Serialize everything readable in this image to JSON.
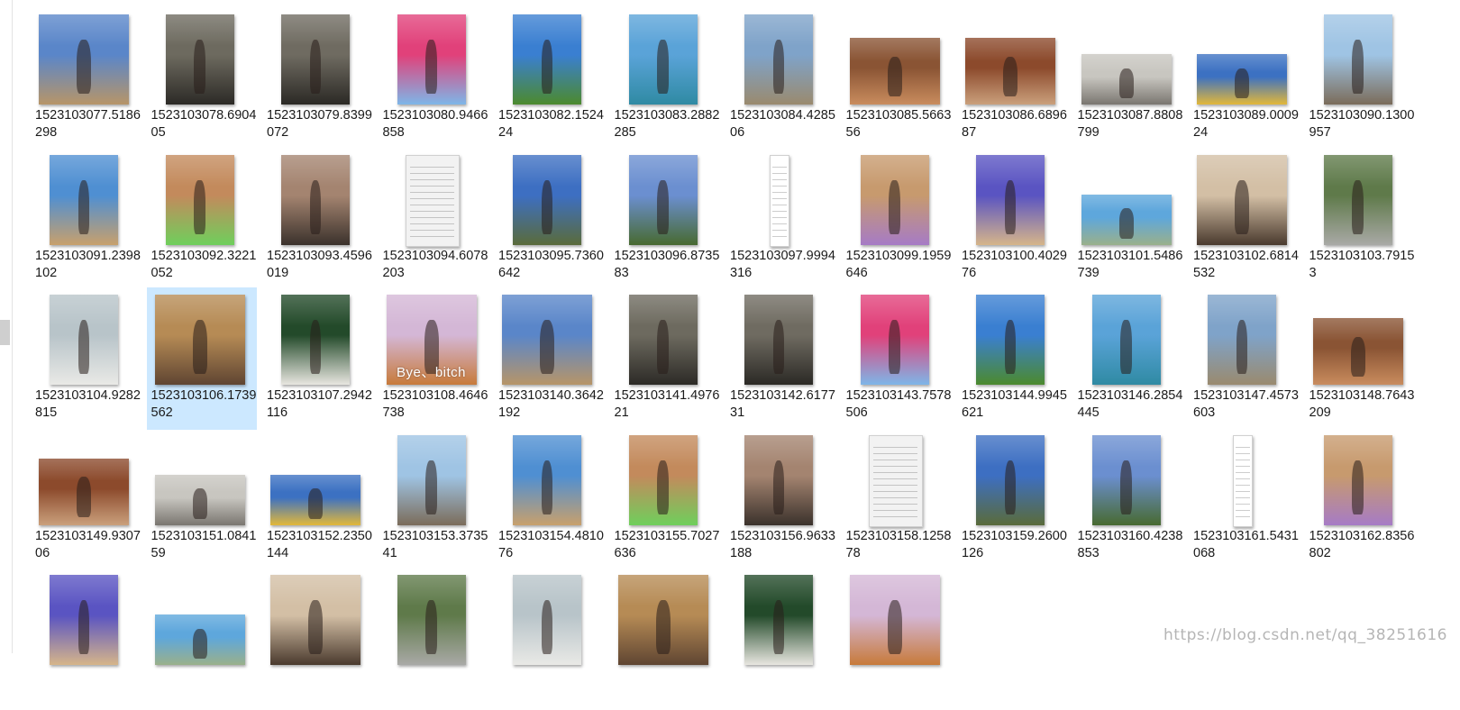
{
  "files": [
    {
      "name": "1523103077.5186298",
      "orientation": "square",
      "colors": [
        "#5a86c9",
        "#b79568"
      ]
    },
    {
      "name": "1523103078.690405",
      "orientation": "portrait",
      "colors": [
        "#6d6a5f",
        "#2c2a26"
      ]
    },
    {
      "name": "1523103079.8399072",
      "orientation": "portrait",
      "colors": [
        "#6f6b61",
        "#2b2925"
      ]
    },
    {
      "name": "1523103080.9466858",
      "orientation": "portrait",
      "colors": [
        "#e1417a",
        "#7eb6e8"
      ]
    },
    {
      "name": "1523103082.152424",
      "orientation": "portrait",
      "colors": [
        "#3a7fd1",
        "#4c8a2d"
      ]
    },
    {
      "name": "1523103083.2882285",
      "orientation": "portrait",
      "colors": [
        "#5aa3d8",
        "#2f8aa3"
      ]
    },
    {
      "name": "1523103084.428506",
      "orientation": "portrait",
      "colors": [
        "#7fa3c9",
        "#9a8a6e"
      ]
    },
    {
      "name": "1523103085.566356",
      "orientation": "landscape",
      "colors": [
        "#8a5434",
        "#c98c5e"
      ]
    },
    {
      "name": "1523103086.689687",
      "orientation": "landscape",
      "colors": [
        "#8c4a2c",
        "#caa07c"
      ]
    },
    {
      "name": "1523103087.8808799",
      "orientation": "wide",
      "colors": [
        "#c8c6c0",
        "#7a7670"
      ]
    },
    {
      "name": "1523103089.000924",
      "orientation": "wide",
      "colors": [
        "#3c71c2",
        "#e2b83a"
      ]
    },
    {
      "name": "1523103090.1300957",
      "orientation": "portrait",
      "colors": [
        "#9fc4e4",
        "#7b6c5a"
      ]
    },
    {
      "name": "1523103091.2398102",
      "orientation": "portrait",
      "colors": [
        "#4f8fd2",
        "#c8a06c"
      ]
    },
    {
      "name": "1523103092.3221052",
      "orientation": "portrait",
      "colors": [
        "#c38a5c",
        "#6fcf5c"
      ]
    },
    {
      "name": "1523103093.4596019",
      "orientation": "portrait",
      "colors": [
        "#a48470",
        "#3b322c"
      ]
    },
    {
      "name": "1523103094.6078203",
      "orientation": "document",
      "colors": [
        "#f2f2f2",
        "#b0b0b0"
      ]
    },
    {
      "name": "1523103095.7360642",
      "orientation": "portrait",
      "colors": [
        "#3d6fc2",
        "#5a6b3a"
      ]
    },
    {
      "name": "1523103096.873583",
      "orientation": "portrait",
      "colors": [
        "#6b8fd0",
        "#486a30"
      ]
    },
    {
      "name": "1523103097.9994316",
      "orientation": "strip",
      "colors": [
        "#ffffff",
        "#b8b8b8"
      ]
    },
    {
      "name": "1523103099.1959646",
      "orientation": "portrait",
      "colors": [
        "#c79a6e",
        "#a67bc6"
      ]
    },
    {
      "name": "1523103100.402976",
      "orientation": "portrait",
      "colors": [
        "#5a54c2",
        "#d6b58a"
      ]
    },
    {
      "name": "1523103101.5486739",
      "orientation": "wide",
      "colors": [
        "#5ea7dc",
        "#9ab08a"
      ]
    },
    {
      "name": "1523103102.6814532",
      "orientation": "square",
      "colors": [
        "#d3bfa5",
        "#4a3a2e"
      ]
    },
    {
      "name": "1523103103.79153",
      "orientation": "portrait",
      "colors": [
        "#5f7a4a",
        "#a9a9a6"
      ]
    },
    {
      "name": "1523103104.9282815",
      "orientation": "portrait",
      "colors": [
        "#b8c4c9",
        "#e9e9e6"
      ]
    },
    {
      "name": "1523103106.1739562",
      "orientation": "square",
      "colors": [
        "#b68b55",
        "#5f4532"
      ],
      "selected": true
    },
    {
      "name": "1523103107.2942116",
      "orientation": "portrait",
      "colors": [
        "#234a2a",
        "#e8e6e0"
      ]
    },
    {
      "name": "1523103108.4646738",
      "orientation": "square",
      "colors": [
        "#d4b7d6",
        "#c77a3a"
      ],
      "caption": "Bye、bitch"
    },
    {
      "name": "1523103140.3642192",
      "orientation": "square",
      "colors": [
        "#5a86c9",
        "#b79568"
      ]
    },
    {
      "name": "1523103141.497621",
      "orientation": "portrait",
      "colors": [
        "#6d6a5f",
        "#2c2a26"
      ]
    },
    {
      "name": "1523103142.617731",
      "orientation": "portrait",
      "colors": [
        "#6f6b61",
        "#2b2925"
      ]
    },
    {
      "name": "1523103143.7578506",
      "orientation": "portrait",
      "colors": [
        "#e1417a",
        "#7eb6e8"
      ]
    },
    {
      "name": "1523103144.9945621",
      "orientation": "portrait",
      "colors": [
        "#3a7fd1",
        "#4c8a2d"
      ]
    },
    {
      "name": "1523103146.2854445",
      "orientation": "portrait",
      "colors": [
        "#5aa3d8",
        "#2f8aa3"
      ]
    },
    {
      "name": "1523103147.4573603",
      "orientation": "portrait",
      "colors": [
        "#7fa3c9",
        "#9a8a6e"
      ]
    },
    {
      "name": "1523103148.7643209",
      "orientation": "landscape",
      "colors": [
        "#8a5434",
        "#c98c5e"
      ]
    },
    {
      "name": "1523103149.930706",
      "orientation": "landscape",
      "colors": [
        "#8c4a2c",
        "#caa07c"
      ]
    },
    {
      "name": "1523103151.084159",
      "orientation": "wide",
      "colors": [
        "#c8c6c0",
        "#7a7670"
      ]
    },
    {
      "name": "1523103152.2350144",
      "orientation": "wide",
      "colors": [
        "#3c71c2",
        "#e2b83a"
      ]
    },
    {
      "name": "1523103153.373541",
      "orientation": "portrait",
      "colors": [
        "#9fc4e4",
        "#7b6c5a"
      ]
    },
    {
      "name": "1523103154.481076",
      "orientation": "portrait",
      "colors": [
        "#4f8fd2",
        "#c8a06c"
      ]
    },
    {
      "name": "1523103155.7027636",
      "orientation": "portrait",
      "colors": [
        "#c38a5c",
        "#6fcf5c"
      ]
    },
    {
      "name": "1523103156.9633188",
      "orientation": "portrait",
      "colors": [
        "#a48470",
        "#3b322c"
      ]
    },
    {
      "name": "1523103158.125878",
      "orientation": "document",
      "colors": [
        "#f2f2f2",
        "#b0b0b0"
      ]
    },
    {
      "name": "1523103159.2600126",
      "orientation": "portrait",
      "colors": [
        "#3d6fc2",
        "#5a6b3a"
      ]
    },
    {
      "name": "1523103160.4238853",
      "orientation": "portrait",
      "colors": [
        "#6b8fd0",
        "#486a30"
      ]
    },
    {
      "name": "1523103161.5431068",
      "orientation": "strip",
      "colors": [
        "#ffffff",
        "#b8b8b8"
      ]
    },
    {
      "name": "1523103162.8356802",
      "orientation": "portrait",
      "colors": [
        "#c79a6e",
        "#a67bc6"
      ]
    },
    {
      "name": "",
      "orientation": "portrait",
      "colors": [
        "#5a54c2",
        "#d6b58a"
      ]
    },
    {
      "name": "",
      "orientation": "wide",
      "colors": [
        "#5ea7dc",
        "#9ab08a"
      ]
    },
    {
      "name": "",
      "orientation": "square",
      "colors": [
        "#d3bfa5",
        "#4a3a2e"
      ]
    },
    {
      "name": "",
      "orientation": "portrait",
      "colors": [
        "#5f7a4a",
        "#a9a9a6"
      ]
    },
    {
      "name": "",
      "orientation": "portrait",
      "colors": [
        "#b8c4c9",
        "#e9e9e6"
      ]
    },
    {
      "name": "",
      "orientation": "square",
      "colors": [
        "#b68b55",
        "#5f4532"
      ]
    },
    {
      "name": "",
      "orientation": "portrait",
      "colors": [
        "#234a2a",
        "#e8e6e0"
      ]
    },
    {
      "name": "",
      "orientation": "square",
      "colors": [
        "#d4b7d6",
        "#c77a3a"
      ]
    }
  ],
  "watermark": "https://blog.csdn.net/qq_38251616",
  "accent": {
    "selection": "#cce8ff"
  }
}
